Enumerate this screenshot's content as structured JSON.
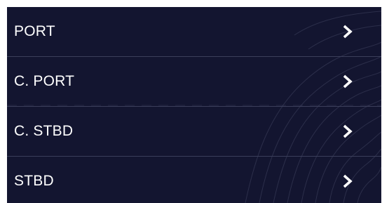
{
  "menu": {
    "items": [
      {
        "label": "PORT",
        "icon": "chevron-right-icon"
      },
      {
        "label": "C. PORT",
        "icon": "chevron-right-icon"
      },
      {
        "label": "C. STBD",
        "icon": "chevron-right-icon"
      },
      {
        "label": "STBD",
        "icon": "chevron-right-icon"
      }
    ]
  },
  "colors": {
    "background": "#131530",
    "text": "#ffffff",
    "divider": "#3b3e5a",
    "contour": "#4a4d6a"
  }
}
